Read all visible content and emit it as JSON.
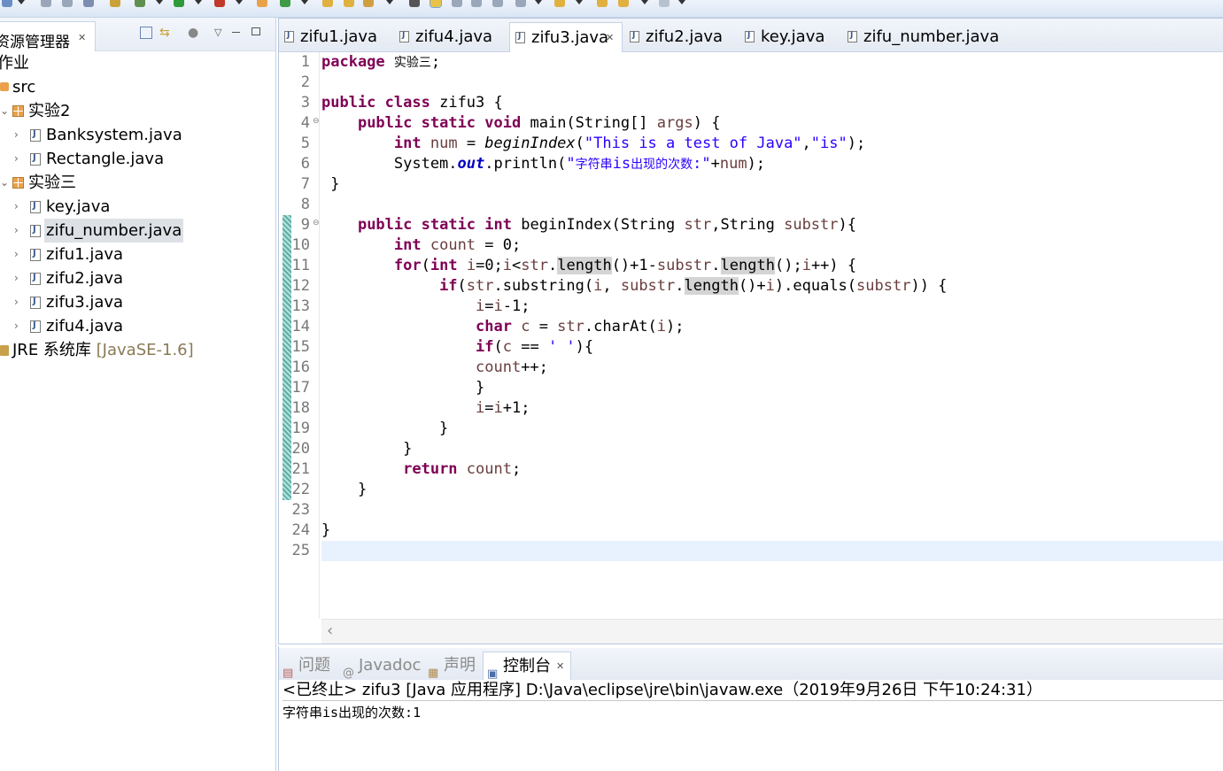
{
  "explorer": {
    "title": "资源管理器",
    "close": "✕",
    "items": [
      {
        "label": "作业",
        "kind": "project"
      },
      {
        "label": "src",
        "kind": "folder"
      },
      {
        "label": "实验2",
        "kind": "package"
      },
      {
        "label": "Banksystem.java",
        "kind": "file"
      },
      {
        "label": "Rectangle.java",
        "kind": "file"
      },
      {
        "label": "实验三",
        "kind": "package"
      },
      {
        "label": "key.java",
        "kind": "file"
      },
      {
        "label": "zifu_number.java",
        "kind": "file",
        "selected": true
      },
      {
        "label": "zifu1.java",
        "kind": "file"
      },
      {
        "label": "zifu2.java",
        "kind": "file"
      },
      {
        "label": "zifu3.java",
        "kind": "file"
      },
      {
        "label": "zifu4.java",
        "kind": "file"
      },
      {
        "label": "JRE 系统库",
        "kind": "library",
        "suffix": "[JavaSE-1.6]"
      }
    ]
  },
  "editor": {
    "tabs": [
      {
        "label": "zifu1.java",
        "active": false
      },
      {
        "label": "zifu4.java",
        "active": false
      },
      {
        "label": "zifu3.java",
        "active": true
      },
      {
        "label": "zifu2.java",
        "active": false
      },
      {
        "label": "key.java",
        "active": false
      },
      {
        "label": "zifu_number.java",
        "active": false
      }
    ],
    "tab_close": "✕",
    "line_numbers": [
      "1",
      "2",
      "3",
      "4",
      "5",
      "6",
      "7",
      "8",
      "9",
      "10",
      "11",
      "12",
      "13",
      "14",
      "15",
      "16",
      "17",
      "18",
      "19",
      "20",
      "21",
      "22",
      "23",
      "24",
      "25"
    ],
    "current_line": 25
  },
  "console": {
    "tabs": [
      {
        "label": "问题",
        "icon": "problems-icon",
        "active": false
      },
      {
        "label": "Javadoc",
        "icon": "javadoc-icon",
        "active": false
      },
      {
        "label": "声明",
        "icon": "declaration-icon",
        "active": false
      },
      {
        "label": "控制台",
        "icon": "console-icon",
        "active": true
      }
    ],
    "tab_close": "✕",
    "status": "<已终止> zifu3 [Java 应用程序] D:\\Java\\eclipse\\jre\\bin\\javaw.exe（2019年9月26日 下午10:24:31）",
    "output": "字符串is出现的次数:1"
  },
  "colors": {
    "keyword": "#7f0055",
    "string": "#2a00ff",
    "field": "#0000c0",
    "current_line": "#e8f2fe",
    "change_bar": "#5bb0a8"
  }
}
